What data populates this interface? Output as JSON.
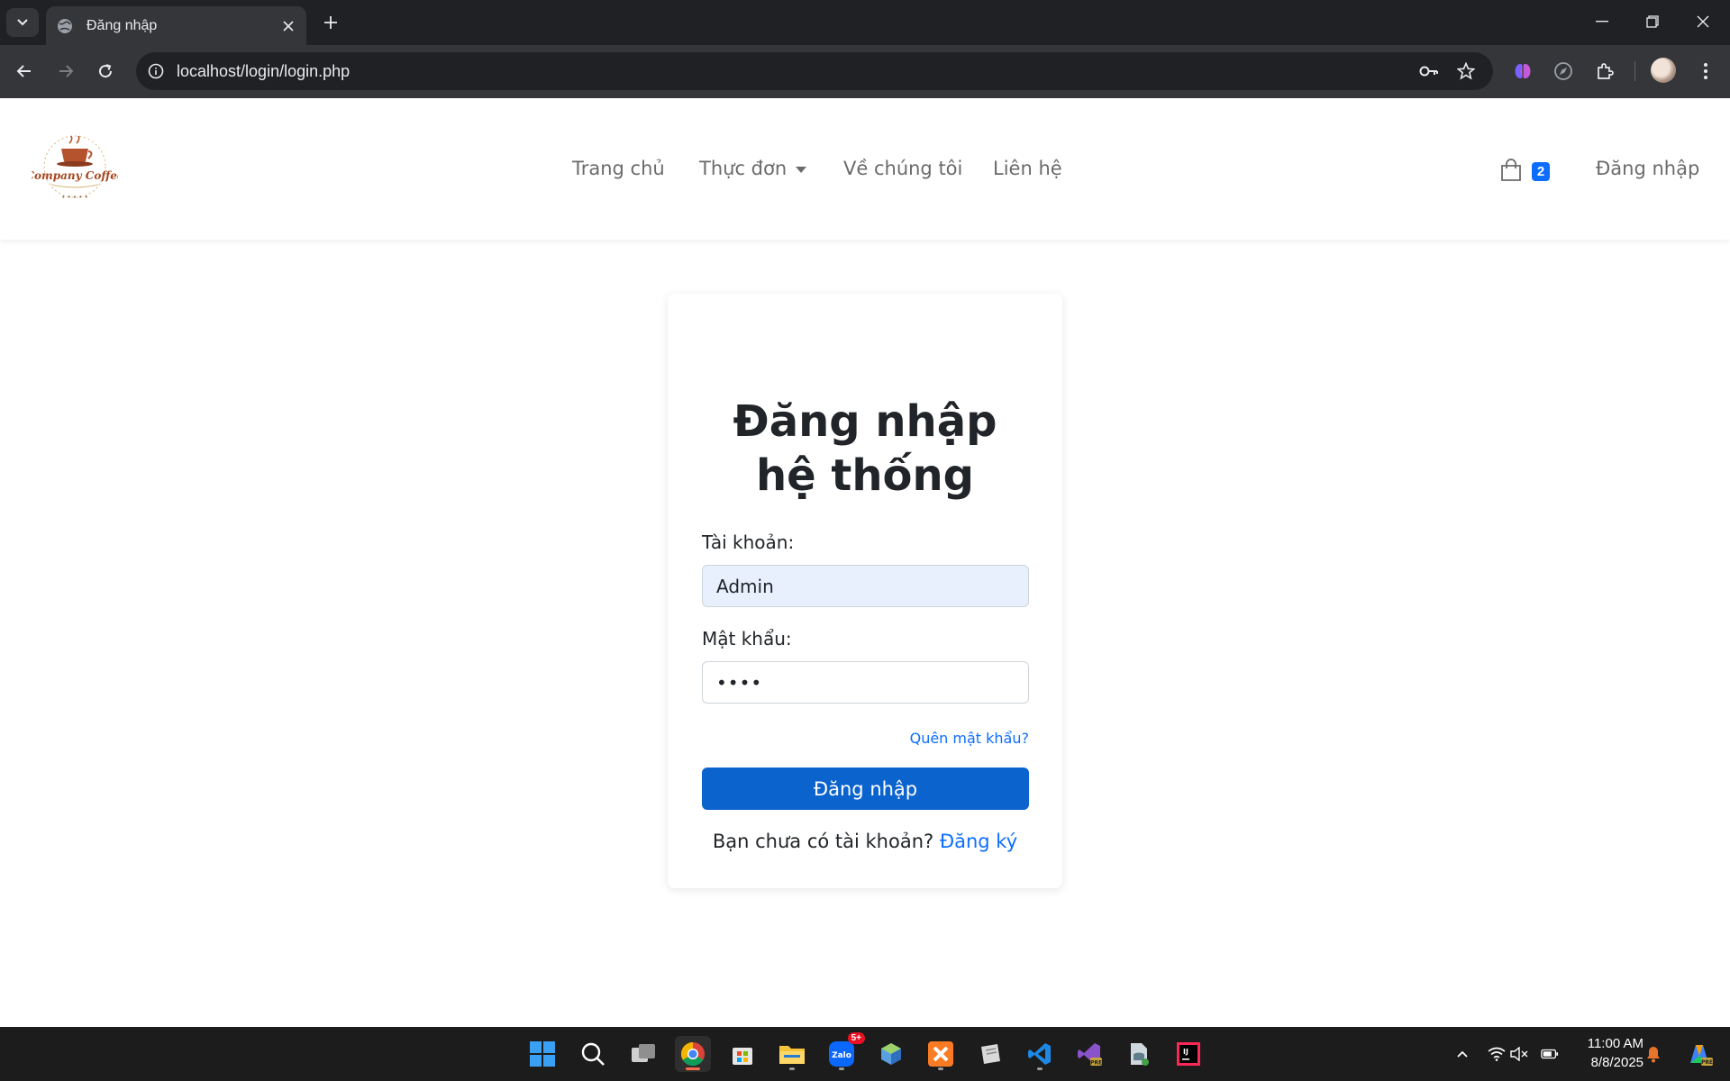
{
  "browser": {
    "tab_title": "Đăng nhập",
    "url": "localhost/login/login.php"
  },
  "site": {
    "logo_text": "Company Coffee",
    "menu": [
      {
        "label": "Trang chủ"
      },
      {
        "label": "Thực đơn"
      },
      {
        "label": "Về chúng tôi"
      },
      {
        "label": "Liên hệ"
      }
    ],
    "cart_count": "2",
    "login_link": "Đăng nhập"
  },
  "login": {
    "title": "Đăng nhập hệ thống",
    "username_label": "Tài khoản:",
    "username_value": "Admin",
    "password_label": "Mật khẩu:",
    "password_value": "••••",
    "forgot_link": "Quên mật khẩu?",
    "submit_label": "Đăng nhập",
    "signup_prompt": "Bạn chưa có tài khoản?",
    "signup_link": "Đăng ký"
  },
  "taskbar": {
    "zalo_badge": "5+",
    "time": "11:00 AM",
    "date": "8/8/2025"
  },
  "colors": {
    "primary": "#0d6efd",
    "button": "#0b63ce",
    "chrome_dark": "#202124",
    "chrome_toolbar": "#35363a"
  }
}
